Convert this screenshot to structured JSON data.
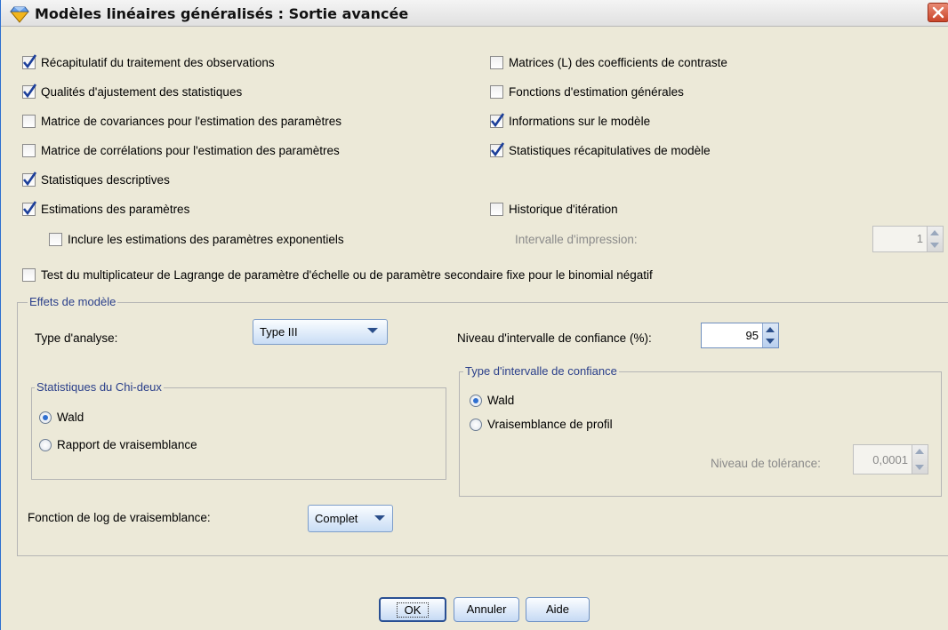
{
  "window": {
    "title": "Modèles linéaires généralisés : Sortie avancée"
  },
  "left_checkboxes": [
    {
      "label": "Récapitulatif du traitement des observations",
      "checked": true
    },
    {
      "label": "Qualités d'ajustement des statistiques",
      "checked": true
    },
    {
      "label": "Matrice de covariances pour l'estimation des paramètres",
      "checked": false
    },
    {
      "label": "Matrice de corrélations pour l'estimation des paramètres",
      "checked": false
    },
    {
      "label": "Statistiques descriptives",
      "checked": true
    },
    {
      "label": "Estimations des paramètres",
      "checked": true
    }
  ],
  "exponential_checkbox": {
    "label": "Inclure les estimations des paramètres exponentiels",
    "checked": false
  },
  "right_checkboxes": [
    {
      "label": "Matrices (L) des coefficients de contraste",
      "checked": false
    },
    {
      "label": "Fonctions d'estimation générales",
      "checked": false
    },
    {
      "label": "Informations sur le modèle",
      "checked": true
    },
    {
      "label": "Statistiques récapitulatives de modèle",
      "checked": true
    }
  ],
  "iteration": {
    "label": "Historique d'itération",
    "checked": false,
    "print_interval_label": "Intervalle d'impression:",
    "print_interval_value": "1"
  },
  "lagrange_checkbox": {
    "label": "Test du multiplicateur de Lagrange de paramètre d'échelle ou de paramètre secondaire fixe pour le binomial négatif",
    "checked": false
  },
  "model_effects": {
    "legend": "Effets de modèle",
    "analysis_type_label": "Type d'analyse:",
    "analysis_type_value": "Type III",
    "confidence_level_label": "Niveau d'intervalle de confiance (%):",
    "confidence_level_value": "95",
    "chi_square": {
      "legend": "Statistiques du Chi-deux",
      "options": [
        "Wald",
        "Rapport de vraisemblance"
      ],
      "selected": 0
    },
    "ci_type": {
      "legend": "Type d'intervalle de confiance",
      "options": [
        "Wald",
        "Vraisemblance de profil"
      ],
      "selected": 0,
      "tolerance_label": "Niveau de tolérance:",
      "tolerance_value": "0,0001"
    },
    "log_likelihood_label": "Fonction de log de vraisemblance:",
    "log_likelihood_value": "Complet"
  },
  "buttons": {
    "ok": "OK",
    "cancel": "Annuler",
    "help": "Aide"
  },
  "colors": {
    "check": "#1c3f9a",
    "accent": "#2f6fd0",
    "close": "#c9452a"
  }
}
